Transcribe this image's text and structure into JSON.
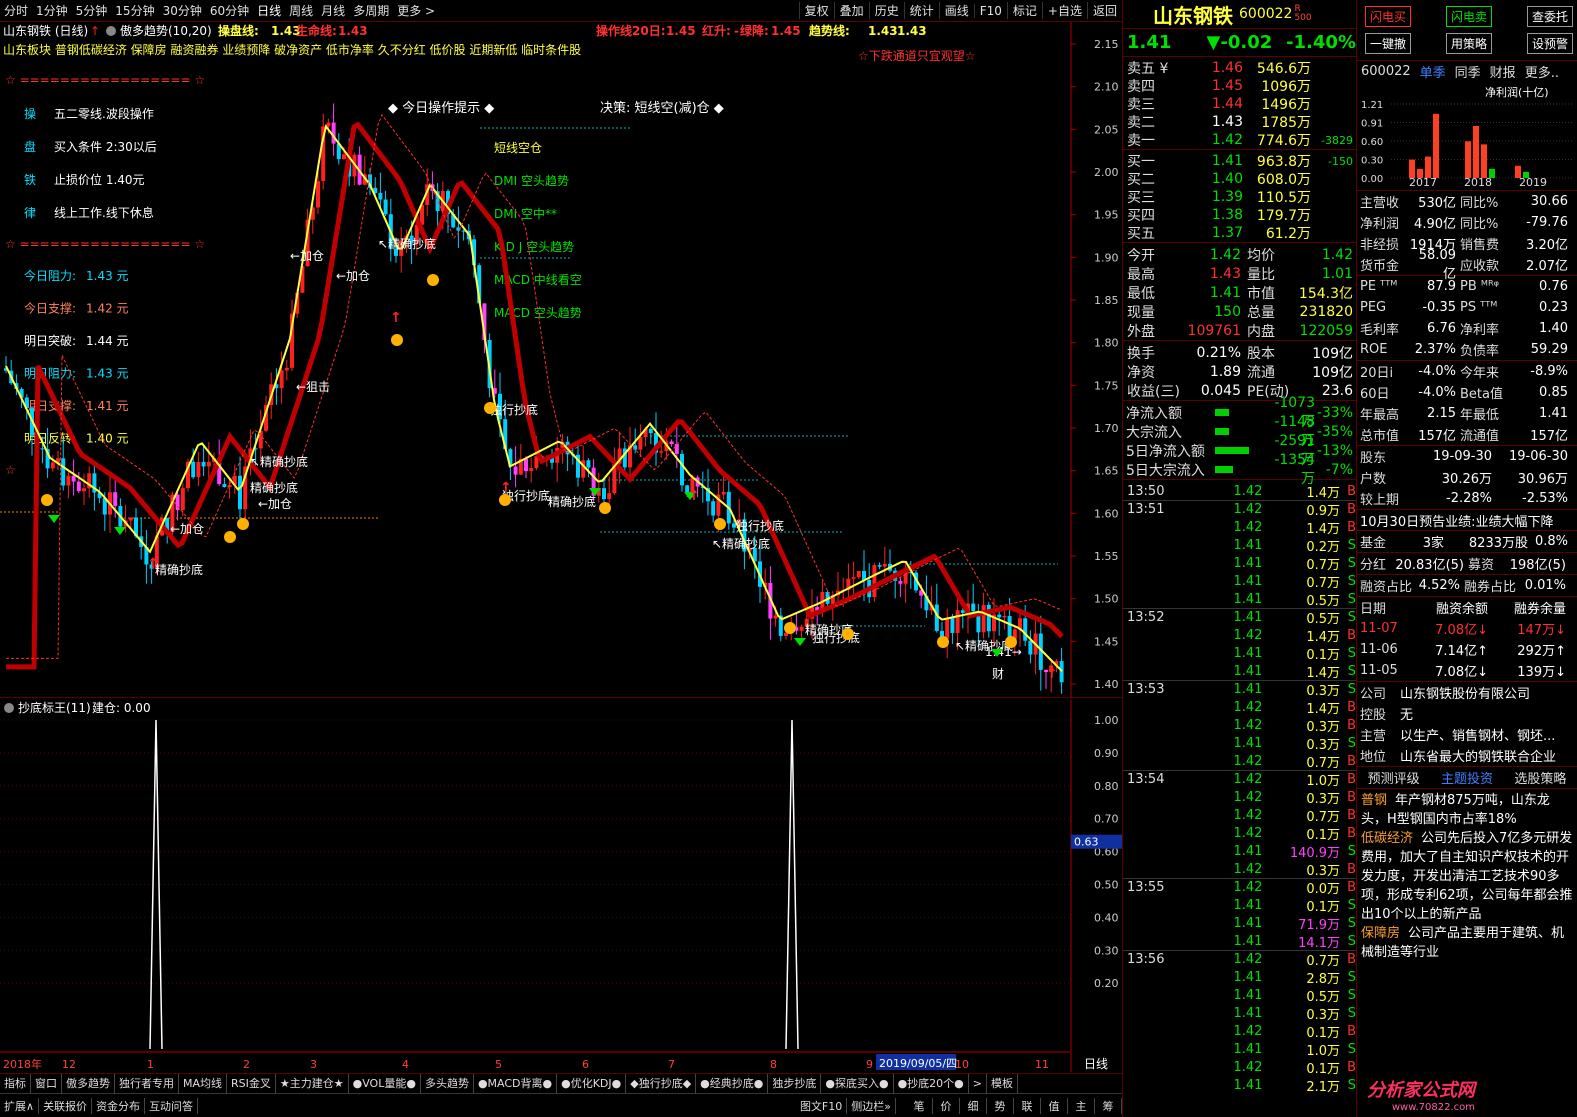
{
  "toolbar": {
    "periods": [
      "分时",
      "1分钟",
      "5分钟",
      "15分钟",
      "30分钟",
      "60分钟",
      "日线",
      "周线",
      "月线",
      "多周期",
      "更多 >"
    ],
    "actions": [
      "复权",
      "叠加",
      "历史",
      "统计",
      "画线",
      "F10",
      "标记",
      "+自选",
      "返回"
    ]
  },
  "chart": {
    "title": "山东钢铁 (日线)",
    "indicator": "傲多趋势(10,20)",
    "lines": {
      "cpx_label": "操盘线:",
      "cpx_val": "1.43",
      "smx_label": "生命线:",
      "smx_val": "1.43",
      "czx_label": "操作线20日:",
      "czx_val": "1.45",
      "hs_label": "红升:",
      "hs_val": "-",
      "lj_label": "绿降:",
      "lj_val": "1.45",
      "qsx_label": "趋势线:",
      "qsx_val": "1.43",
      "qsx_val2": "1.43"
    },
    "concepts": "山东板块 普钢低碳经济 保障房 融资融券 业绩预降 破净资产 低市净率 久不分红 低价股 近期新低 临时条件股",
    "warning": "☆下跌通道只宜观望☆",
    "stars": "☆ ================= ☆",
    "panel": [
      {
        "k": "操",
        "v": "五二零线.波段操作"
      },
      {
        "k": "盘",
        "v": "买入条件 2:30以后"
      },
      {
        "k": "铁",
        "v": "止损价位 1.40元"
      },
      {
        "k": "律",
        "v": "线上工作.线下休息"
      }
    ],
    "levels": [
      {
        "label": "今日阻力:",
        "val": "1.43 元",
        "color": "#00e0ff"
      },
      {
        "label": "今日支撑:",
        "val": "1.42 元",
        "color": "#ff8060"
      },
      {
        "label": "明日突破:",
        "val": "1.44 元",
        "color": "#ffffff"
      },
      {
        "label": "明日阻力:",
        "val": "1.43 元",
        "color": "#00e0ff"
      },
      {
        "label": "明日支撑:",
        "val": "1.41 元",
        "color": "#ff8060"
      },
      {
        "label": "明日反转:",
        "val": "1.40 元",
        "color": "#ffff40"
      }
    ],
    "op_title": "◆ 今日操作提示 ◆",
    "decision": "决策: 短线空(减)仓 ◆",
    "tips": [
      "短线空仓",
      "DMI 空头趋势",
      "DMI 空中**",
      "K D J 空头趋势",
      "MACD 中线看空",
      "MACD 空头趋势"
    ],
    "annotations": [
      "精确抄底",
      "←加仓",
      "精确抄底",
      "←加仓",
      "←加仓",
      "↖精确抄底",
      "←狙击",
      "←加仓",
      "↖精确抄底",
      "独行抄底",
      "独行抄底",
      "精确抄底",
      "↖精确抄底",
      "独行抄底",
      "精确抄底",
      "独行抄底",
      "↖精确抄底",
      "1.41→",
      "财"
    ],
    "price_axis": [
      "2.15",
      "2.10",
      "2.05",
      "2.00",
      "1.95",
      "1.90",
      "1.85",
      "1.80",
      "1.75",
      "1.70",
      "1.65",
      "1.60",
      "1.55",
      "1.50",
      "1.45",
      "1.40"
    ],
    "sub_title": "抄底标王(11)",
    "sub_value": "建仓: 0.00",
    "sub_axis": [
      "1.00",
      "0.90",
      "0.80",
      "0.70",
      "0.60",
      "0.50",
      "0.40",
      "0.30",
      "0.20"
    ],
    "sub_marker": "0.63",
    "date_axis": [
      "2018年",
      "12",
      "1",
      "2",
      "3",
      "4",
      "5",
      "6",
      "7",
      "8",
      "9",
      "10",
      "11"
    ],
    "date_cursor": "2019/09/05/四",
    "date_label": "日线"
  },
  "bottom_tabs": [
    "指标",
    "窗口",
    "傲多趋势",
    "独行者专用",
    "MA均线",
    "RSI金叉",
    "★主力建仓★",
    "●VOL量能●",
    "多头趋势",
    "●MACD背离●",
    "●优化KDJ●",
    "◆独行抄底◆",
    "●经典抄底●",
    "独步抄底",
    "●探底买入●",
    "●抄底20个●",
    ">",
    "模板"
  ],
  "status": [
    "扩展∧",
    "关联报价",
    "资金分布",
    "互动问答",
    "图文F10",
    "侧边栏»",
    "笔",
    "价",
    "细",
    "势",
    "联",
    "值",
    "主",
    "筹"
  ],
  "stock": {
    "name": "山东钢铁",
    "code": "600022",
    "badge": "R",
    "badge2": "500",
    "price": "1.41",
    "change": "▼-0.02",
    "pct": "-1.40%"
  },
  "order_book": {
    "sell": [
      {
        "l": "卖五 ¥",
        "p": "1.46",
        "v": "546.6万",
        "d": ""
      },
      {
        "l": "卖四",
        "p": "1.45",
        "v": "1096万",
        "d": ""
      },
      {
        "l": "卖三",
        "p": "1.44",
        "v": "1496万",
        "d": ""
      },
      {
        "l": "卖二",
        "p": "1.43",
        "v": "1785万",
        "d": ""
      },
      {
        "l": "卖一",
        "p": "1.42",
        "v": "774.6万",
        "d": "-3829"
      }
    ],
    "buy": [
      {
        "l": "买一",
        "p": "1.41",
        "v": "963.8万",
        "d": "-150"
      },
      {
        "l": "买二",
        "p": "1.40",
        "v": "608.0万",
        "d": ""
      },
      {
        "l": "买三",
        "p": "1.39",
        "v": "110.5万",
        "d": ""
      },
      {
        "l": "买四",
        "p": "1.38",
        "v": "179.7万",
        "d": ""
      },
      {
        "l": "买五",
        "p": "1.37",
        "v": "61.2万",
        "d": ""
      }
    ]
  },
  "quotes": [
    [
      "今开",
      "1.42",
      "均价",
      "1.42"
    ],
    [
      "最高",
      "1.43",
      "量比",
      "1.01"
    ],
    [
      "最低",
      "1.41",
      "市值",
      "154.3亿"
    ],
    [
      "现量",
      "150",
      "总量",
      "231820"
    ],
    [
      "外盘",
      "109761",
      "内盘",
      "122059"
    ]
  ],
  "quotes2": [
    [
      "换手",
      "0.21%",
      "股本",
      "109亿"
    ],
    [
      "净资",
      "1.89",
      "流通",
      "109亿"
    ],
    [
      "收益(三)",
      "0.045",
      "PE(动)",
      "23.6"
    ]
  ],
  "flows": [
    {
      "l": "净流入额",
      "v": "-1073万",
      "p": "-33%",
      "w": 14
    },
    {
      "l": "大宗流入",
      "v": "-1148万",
      "p": "-35%",
      "w": 14
    },
    {
      "l": "5日净流入额",
      "v": "-2591万",
      "p": "-13%",
      "w": 34
    },
    {
      "l": "5日大宗流入",
      "v": "-1354万",
      "p": "-7%",
      "w": 18
    }
  ],
  "ticks": [
    {
      "t": "13:50",
      "p": "1.42",
      "v": "1.4万",
      "bs": "B"
    },
    {
      "t": "13:51",
      "p": "1.42",
      "v": "0.9万",
      "bs": "B"
    },
    {
      "t": "",
      "p": "1.42",
      "v": "1.4万",
      "bs": "B"
    },
    {
      "t": "",
      "p": "1.41",
      "v": "0.2万",
      "bs": "S"
    },
    {
      "t": "",
      "p": "1.41",
      "v": "0.7万",
      "bs": "S"
    },
    {
      "t": "",
      "p": "1.41",
      "v": "0.7万",
      "bs": "S"
    },
    {
      "t": "",
      "p": "1.41",
      "v": "0.5万",
      "bs": "S"
    },
    {
      "t": "13:52",
      "p": "1.41",
      "v": "0.5万",
      "bs": "S"
    },
    {
      "t": "",
      "p": "1.42",
      "v": "1.4万",
      "bs": "B"
    },
    {
      "t": "",
      "p": "1.41",
      "v": "0.1万",
      "bs": "S"
    },
    {
      "t": "",
      "p": "1.41",
      "v": "1.4万",
      "bs": "S"
    },
    {
      "t": "13:53",
      "p": "1.41",
      "v": "0.3万",
      "bs": "S"
    },
    {
      "t": "",
      "p": "1.42",
      "v": "1.4万",
      "bs": "B"
    },
    {
      "t": "",
      "p": "1.42",
      "v": "0.3万",
      "bs": "B"
    },
    {
      "t": "",
      "p": "1.41",
      "v": "0.3万",
      "bs": "S"
    },
    {
      "t": "",
      "p": "1.42",
      "v": "0.7万",
      "bs": "B"
    },
    {
      "t": "13:54",
      "p": "1.42",
      "v": "1.0万",
      "bs": "B"
    },
    {
      "t": "",
      "p": "1.42",
      "v": "0.3万",
      "bs": "B"
    },
    {
      "t": "",
      "p": "1.42",
      "v": "0.7万",
      "bs": "B"
    },
    {
      "t": "",
      "p": "1.42",
      "v": "0.1万",
      "bs": "B"
    },
    {
      "t": "",
      "p": "1.41",
      "v": "140.9万",
      "bs": "S",
      "hl": true
    },
    {
      "t": "",
      "p": "1.42",
      "v": "0.3万",
      "bs": "B"
    },
    {
      "t": "13:55",
      "p": "1.42",
      "v": "0.0万",
      "bs": "B"
    },
    {
      "t": "",
      "p": "1.41",
      "v": "0.1万",
      "bs": "S"
    },
    {
      "t": "",
      "p": "1.41",
      "v": "71.9万",
      "bs": "S",
      "hl": true
    },
    {
      "t": "",
      "p": "1.41",
      "v": "14.1万",
      "bs": "S",
      "hl": true
    },
    {
      "t": "13:56",
      "p": "1.42",
      "v": "0.7万",
      "bs": "B"
    },
    {
      "t": "",
      "p": "1.41",
      "v": "2.8万",
      "bs": "S"
    },
    {
      "t": "",
      "p": "1.41",
      "v": "0.5万",
      "bs": "S"
    },
    {
      "t": "",
      "p": "1.41",
      "v": "0.3万",
      "bs": "S"
    },
    {
      "t": "",
      "p": "1.42",
      "v": "0.1万",
      "bs": "B"
    },
    {
      "t": "",
      "p": "1.41",
      "v": "1.0万",
      "bs": "S"
    },
    {
      "t": "",
      "p": "1.42",
      "v": "0.1万",
      "bs": "B"
    },
    {
      "t": "",
      "p": "1.41",
      "v": "2.1万",
      "bs": "S"
    }
  ],
  "side_buttons": [
    [
      "闪电买",
      "闪电卖",
      "查委托"
    ],
    [
      "一键撤",
      "用策略",
      "设预警"
    ]
  ],
  "side_tabs": [
    "600022",
    "单季",
    "同季",
    "财报",
    "更多.."
  ],
  "profit_chart": {
    "title": "净利润(十亿)",
    "y": [
      "1.21",
      "0.91",
      "0.60",
      "0.30",
      "0.00"
    ],
    "x": [
      "2017",
      "2018",
      "2019"
    ]
  },
  "fin": [
    [
      "主营收",
      "530亿",
      "同比%",
      "30.66"
    ],
    [
      "净利润",
      "4.90亿",
      "同比%",
      "-79.76"
    ],
    [
      "非经损",
      "1914万",
      "销售费",
      "3.20亿"
    ],
    [
      "货币金",
      "58.09亿",
      "应收款",
      "2.07亿"
    ]
  ],
  "fin2": [
    [
      "PE ᵀᵀᴹ",
      "87.9",
      "PB ᴹᴿᵠ",
      "0.76"
    ],
    [
      "PEG",
      "-0.35",
      "PS ᵀᵀᴹ",
      "0.23"
    ],
    [
      "毛利率",
      "6.76",
      "净利率",
      "1.40"
    ],
    [
      "ROE",
      "2.37%",
      "负债率",
      "59.29"
    ]
  ],
  "fin3": [
    [
      "20日i",
      "-4.0%",
      "今年来",
      "-8.9%"
    ],
    [
      "60日",
      "-4.0%",
      "Beta值",
      "0.85"
    ],
    [
      "年最高",
      "2.15",
      "年最低",
      "1.41"
    ],
    [
      "总市值",
      "157亿",
      "流通值",
      "157亿"
    ]
  ],
  "holders": [
    [
      "股东",
      "19-09-30",
      "19-06-30"
    ],
    [
      "户数",
      "30.26万",
      "30.96万"
    ],
    [
      "较上期",
      "-2.28%",
      "-2.53%"
    ]
  ],
  "notice": "10月30日预告业绩:业绩大幅下降",
  "fund": [
    "基金",
    "3家",
    "8233万股",
    "0.8%"
  ],
  "div": [
    "分红",
    "20.83亿(5)",
    "募资",
    "198亿(5)"
  ],
  "margin": [
    "融资占比",
    "4.52%",
    "融券占比",
    "0.01%"
  ],
  "margin_head": [
    "日期",
    "融资余额",
    "融券余量"
  ],
  "margin_rows": [
    [
      "11-07",
      "7.08亿↓",
      "147万↓"
    ],
    [
      "11-06",
      "7.14亿↑",
      "292万↑"
    ],
    [
      "11-05",
      "7.08亿↓",
      "139万↓"
    ]
  ],
  "company": [
    [
      "公司",
      "山东钢铁股份有限公司"
    ],
    [
      "控股",
      "无"
    ],
    [
      "主营",
      "以生产、销售钢材、钢坯..."
    ],
    [
      "地位",
      "山东省最大的钢铁联合企业"
    ]
  ],
  "comp_tabs": [
    "预测评级",
    "主题投资",
    "选股策略"
  ],
  "themes": [
    {
      "k": "普钢",
      "v": "年产钢材875万吨，山东龙头，H型钢国内市占率18%"
    },
    {
      "k": "低碳经济",
      "v": "公司先后投入7亿多元研发费用，加大了自主知识产权技术的开发力度，开发出清洁工艺技术90多项，形成专利62项，公司每年都会推出10个以上的新产品"
    },
    {
      "k": "保障房",
      "v": "公司产品主要用于建筑、机械制造等行业"
    }
  ],
  "watermark": "分析家公式网",
  "watermark2": "www.70822.com"
}
